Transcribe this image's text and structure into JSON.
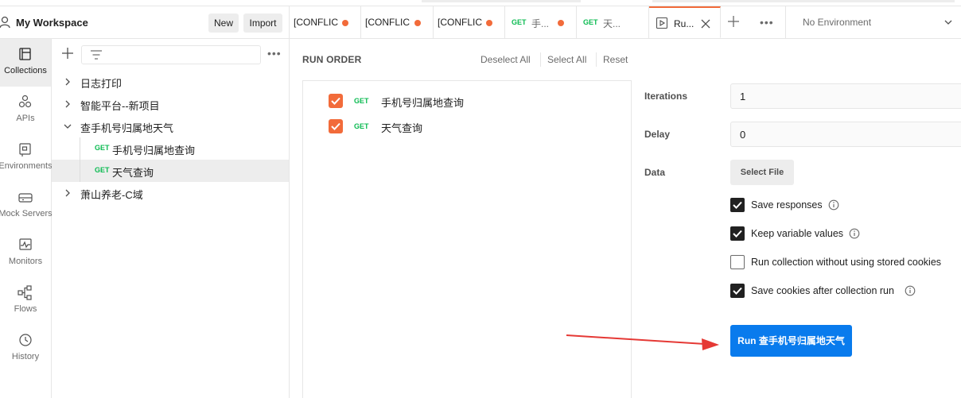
{
  "workspace": {
    "title": "My Workspace",
    "new_label": "New",
    "import_label": "Import"
  },
  "rail": [
    {
      "label": "Collections",
      "icon": "collections-icon"
    },
    {
      "label": "APIs",
      "icon": "apis-icon"
    },
    {
      "label": "Environments",
      "icon": "environments-icon"
    },
    {
      "label": "Mock Servers",
      "icon": "mock-servers-icon"
    },
    {
      "label": "Monitors",
      "icon": "monitors-icon"
    },
    {
      "label": "Flows",
      "icon": "flows-icon"
    },
    {
      "label": "History",
      "icon": "history-icon"
    }
  ],
  "tree": [
    {
      "name": "日志打印"
    },
    {
      "name": "智能平台--新项目"
    },
    {
      "name": "查手机号归属地天气"
    },
    {
      "method": "GET",
      "name": "手机号归属地查询"
    },
    {
      "method": "GET",
      "name": "天气查询"
    },
    {
      "name": "萧山养老-C域"
    }
  ],
  "tabs": [
    {
      "label": "[CONFLIC"
    },
    {
      "label": "[CONFLIC"
    },
    {
      "label": "[CONFLIC"
    },
    {
      "method": "GET",
      "label": "手..."
    },
    {
      "method": "GET",
      "label": "天..."
    },
    {
      "label": "Ru..."
    }
  ],
  "environment": {
    "label": "No Environment"
  },
  "run_order": {
    "heading": "RUN ORDER",
    "deselect_all": "Deselect All",
    "select_all": "Select All",
    "reset": "Reset",
    "items": [
      {
        "method": "GET",
        "name": "手机号归属地查询",
        "checked": true
      },
      {
        "method": "GET",
        "name": "天气查询",
        "checked": true
      }
    ]
  },
  "settings": {
    "iterations_label": "Iterations",
    "iterations_value": "1",
    "delay_label": "Delay",
    "delay_value": "0",
    "data_label": "Data",
    "select_file": "Select File",
    "options": [
      {
        "label": "Save responses",
        "checked": true
      },
      {
        "label": "Keep variable values",
        "checked": true
      },
      {
        "label": "Run collection without using stored cookies",
        "checked": false
      },
      {
        "label": "Save cookies after collection run",
        "checked": true
      }
    ],
    "run_button": "Run 查手机号归属地天气"
  },
  "colors": {
    "accent_orange": "#f26b3a",
    "primary_blue": "#097bed",
    "method_get": "#0cbb52"
  }
}
